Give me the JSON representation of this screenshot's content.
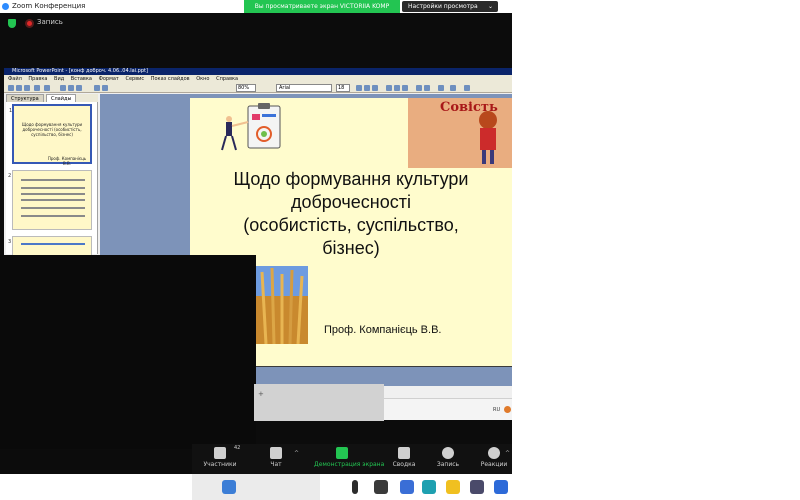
{
  "window": {
    "title": "Zoom Конференция"
  },
  "share_banner": {
    "text": "Вы просматриваете экран VICTORIIA KOMP"
  },
  "view_options": {
    "label": "Настройки просмотра",
    "chevron": "⌄"
  },
  "recording": {
    "label": "Запись",
    "icons": [
      "shield-icon",
      "record-icon"
    ]
  },
  "shared": {
    "app_title": "Microsoft PowerPoint - [конф доброч. 4.06..04.lai.ppt]",
    "menu": [
      "Файл",
      "Правка",
      "Вид",
      "Вставка",
      "Формат",
      "Сервис",
      "Показ слайдов",
      "Окно",
      "Справка"
    ],
    "zoom_value": "80%",
    "font_value": "Arial",
    "size_value": "18",
    "panel_tabs": [
      "Структура",
      "Слайды"
    ],
    "thumbs": [
      {
        "num": "1",
        "text": "Щодо формування культури доброчесності (особистість, суспільство, бізнес)",
        "author": "Проф. Компанієць В.В."
      },
      {
        "num": "2",
        "text": ""
      },
      {
        "num": "3",
        "text": ""
      }
    ],
    "slide": {
      "word": "Совість",
      "title_lines": [
        "Щодо формування культури",
        "доброчесності",
        "(особистість, суспільство,",
        "бізнес)"
      ],
      "author": "Проф. Компанієць В.В."
    },
    "status_lang": "RU"
  },
  "grey_bar": {
    "text": "+"
  },
  "toolbar": {
    "participants": {
      "label": "Участники",
      "count": "42",
      "icon": "participants-icon"
    },
    "chat": {
      "label": "Чат",
      "icon": "chat-icon"
    },
    "share": {
      "label": "Демонстрация экрана",
      "icon": "share-screen-icon"
    },
    "summary": {
      "label": "Сводка",
      "icon": "summary-icon"
    },
    "record": {
      "label": "Запись",
      "icon": "record-button-icon"
    },
    "reactions": {
      "label": "Реакции",
      "icon": "reactions-icon"
    },
    "caret": "^"
  },
  "taskbar": {
    "icons": [
      "start-icon",
      "search-icon",
      "edge-icon",
      "files-icon",
      "calendar-icon",
      "mail-icon"
    ]
  },
  "colors": {
    "zoom_green": "#23c552",
    "zoom_blue": "#2d8cff",
    "slide_bg": "#fffccd",
    "record_red": "#e02828"
  }
}
